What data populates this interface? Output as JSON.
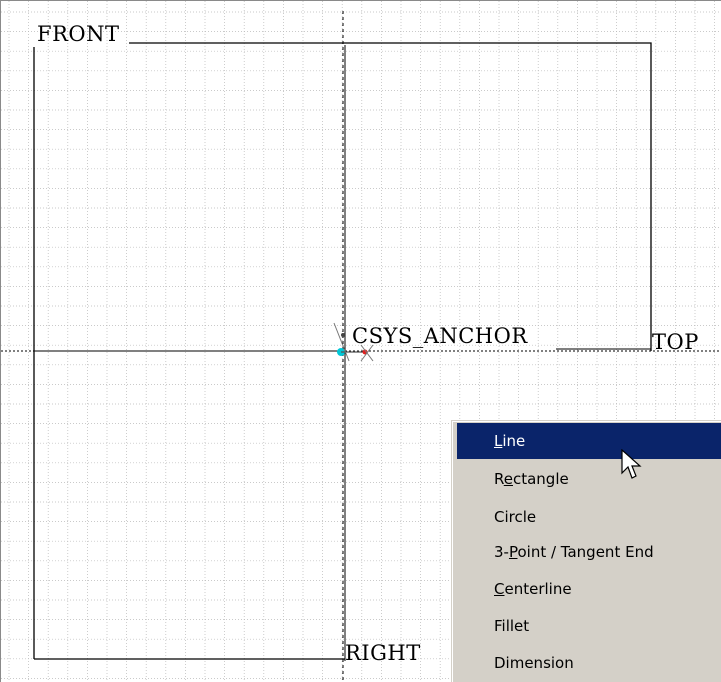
{
  "datum_labels": {
    "front": "FRONT",
    "top": "TOP",
    "right": "RIGHT",
    "csys": "CSYS_ANCHOR"
  },
  "context_menu": {
    "items": [
      {
        "label": "Line",
        "mnemonic": "L",
        "active": true
      },
      {
        "label": "Rectangle",
        "mnemonic": "e",
        "active": false
      },
      {
        "label": "Circle",
        "mnemonic": "",
        "active": false
      },
      {
        "label": "3-Point / Tangent End",
        "mnemonic": "P",
        "active": false
      },
      {
        "label": "Centerline",
        "mnemonic": "C",
        "active": false
      },
      {
        "label": "Fillet",
        "mnemonic": "",
        "active": false
      },
      {
        "label": "Dimension",
        "mnemonic": "",
        "active": false
      }
    ]
  },
  "colors": {
    "grid": "#b8b8b8",
    "menu_bg": "#d4d0c8",
    "menu_highlight": "#0a246a",
    "csys_origin": "#00c8d8",
    "csys_marker": "#e02020"
  },
  "icons": [
    "csys-origin-icon",
    "arrow-cursor-icon"
  ]
}
